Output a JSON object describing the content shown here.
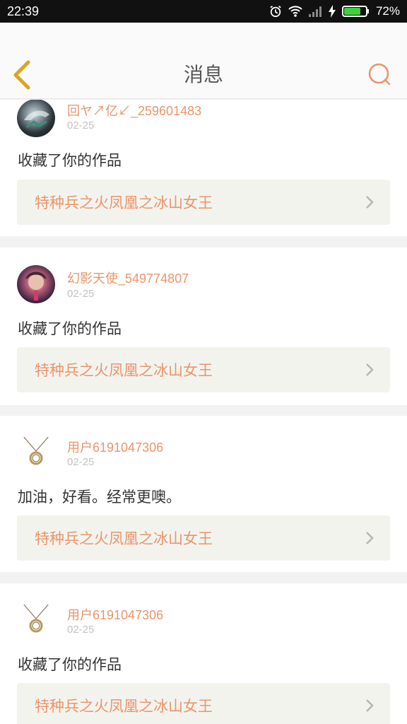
{
  "status_bar": {
    "time": "22:39",
    "battery": "72%"
  },
  "header": {
    "title": "消息",
    "back_icon": "chevron-left-icon",
    "search_icon": "search-icon"
  },
  "colors": {
    "accent": "#e9956a",
    "back": "#d9a520"
  },
  "messages": [
    {
      "user": "回ヤ↗亿↙_259601483",
      "date": "02-25",
      "text": "收藏了你的作品",
      "work": "特种兵之火凤凰之冰山女王",
      "avatar": "avatar-dark-anime"
    },
    {
      "user": "幻影天使_549774807",
      "date": "02-25",
      "text": "收藏了你的作品",
      "work": "特种兵之火凤凰之冰山女王",
      "avatar": "avatar-singer"
    },
    {
      "user": "用户6191047306",
      "date": "02-25",
      "text": "加油，好看。经常更噢。",
      "work": "特种兵之火凤凰之冰山女王",
      "avatar": "avatar-necklace"
    },
    {
      "user": "用户6191047306",
      "date": "02-25",
      "text": "收藏了你的作品",
      "work": "特种兵之火凤凰之冰山女王",
      "avatar": "avatar-necklace"
    }
  ]
}
